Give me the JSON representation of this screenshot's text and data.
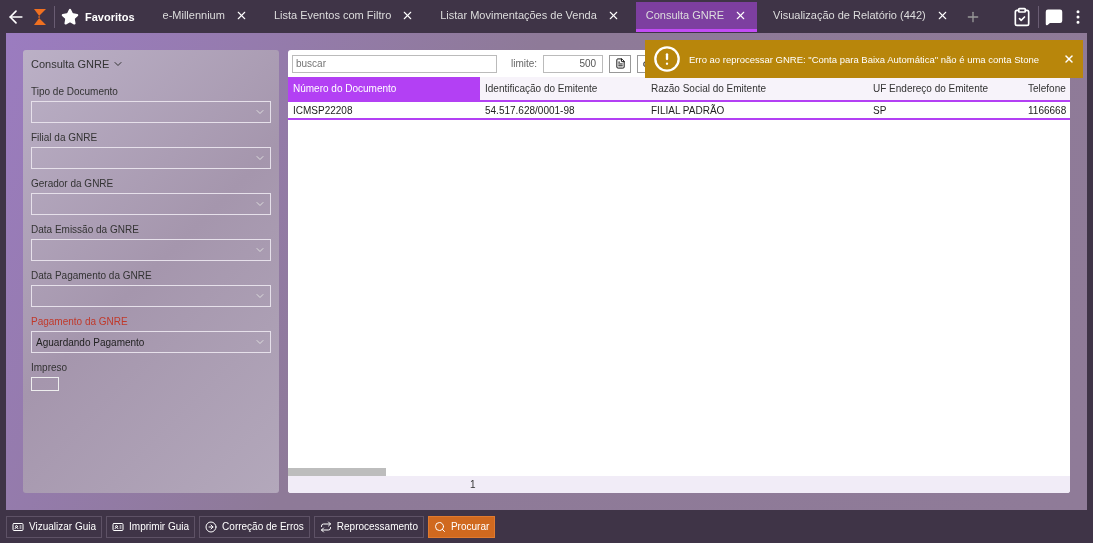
{
  "topbar": {
    "favorites": "Favoritos"
  },
  "tabs": [
    {
      "label": "e-Millennium",
      "selected": false
    },
    {
      "label": "Lista Eventos com Filtro",
      "selected": false
    },
    {
      "label": "Listar Movimentações de Venda",
      "selected": false
    },
    {
      "label": "Consulta GNRE",
      "selected": true
    },
    {
      "label": "Visualização de Relatório (442)",
      "selected": false
    }
  ],
  "filter_panel": {
    "title": "Consulta GNRE",
    "fields": [
      {
        "kind": "select",
        "label": "Tipo de Documento",
        "required": false
      },
      {
        "kind": "select",
        "label": "Filial da GNRE",
        "required": false
      },
      {
        "kind": "select",
        "label": "Gerador da GNRE",
        "required": false
      },
      {
        "kind": "select",
        "label": "Data Emissão da GNRE",
        "required": false
      },
      {
        "kind": "select",
        "label": "Data Pagamento da GNRE",
        "required": false
      },
      {
        "kind": "select",
        "label": "Pagamento da GNRE",
        "required": true,
        "value": "Aguardando Pagamento"
      },
      {
        "kind": "checkbox",
        "label": "Impreso",
        "checked": false
      }
    ]
  },
  "grid": {
    "search": {
      "placeholder": "buscar"
    },
    "limit_label": "limite:",
    "limit": "500",
    "columns": [
      {
        "label": "Número do Documento",
        "selected": true
      },
      {
        "label": "Identificação do Emitente",
        "selected": false
      },
      {
        "label": "Razão Social do Emitente",
        "selected": false
      },
      {
        "label": "UF Endereço do Emitente",
        "selected": false
      },
      {
        "label": "Telefone",
        "selected": false
      }
    ],
    "rows": [
      {
        "selected": true,
        "cells": [
          "ICMSP22208",
          "54.517.628/0001-98",
          "FILIAL PADRÃO",
          "SP",
          "1166668"
        ]
      }
    ],
    "page": "1"
  },
  "toast": {
    "message": "Erro ao reprocessar GNRE: \"Conta para Baixa Automática\" não é uma conta Stone"
  },
  "actions": [
    {
      "label": "Vizualizar Guia",
      "kind": "card",
      "primary": false
    },
    {
      "label": "Imprimir Guia",
      "kind": "card",
      "primary": false
    },
    {
      "label": "Correção de Erros",
      "kind": "arrow",
      "primary": false
    },
    {
      "label": "Reprocessamento",
      "kind": "repeat",
      "primary": false
    },
    {
      "label": "Procurar",
      "kind": "search",
      "primary": true
    }
  ]
}
